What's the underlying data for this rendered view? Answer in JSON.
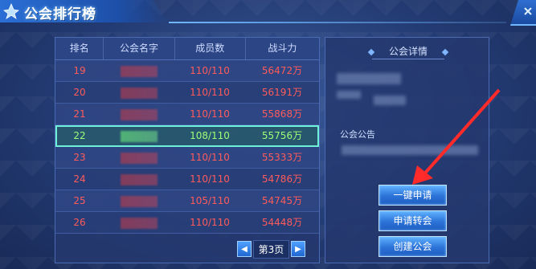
{
  "window": {
    "title": "公会排行榜"
  },
  "table": {
    "headers": [
      "排名",
      "公会名字",
      "成员数",
      "战斗力"
    ],
    "rows": [
      {
        "rank": "19",
        "members": "110/110",
        "power": "56472万"
      },
      {
        "rank": "20",
        "members": "110/110",
        "power": "56191万"
      },
      {
        "rank": "21",
        "members": "110/110",
        "power": "55868万"
      },
      {
        "rank": "22",
        "members": "108/110",
        "power": "55756万",
        "highlight": true
      },
      {
        "rank": "23",
        "members": "110/110",
        "power": "55333万"
      },
      {
        "rank": "24",
        "members": "110/110",
        "power": "54786万"
      },
      {
        "rank": "25",
        "members": "105/110",
        "power": "54745万"
      },
      {
        "rank": "26",
        "members": "110/110",
        "power": "54448万"
      }
    ]
  },
  "pager": {
    "label": "第3页",
    "prev_icon": "triangle-left-icon",
    "next_icon": "triangle-right-icon"
  },
  "details": {
    "title": "公会详情",
    "announcement_label": "公会公告",
    "buttons": {
      "apply_one_click": "一键申请",
      "apply_transfer": "申请转会",
      "create_guild": "创建公会"
    }
  },
  "colors": {
    "rank_red": "#ff5b5b",
    "highlight_green": "#9dff78",
    "highlight_border": "#6ff0d8",
    "arrow_red": "#ff2a2a"
  }
}
